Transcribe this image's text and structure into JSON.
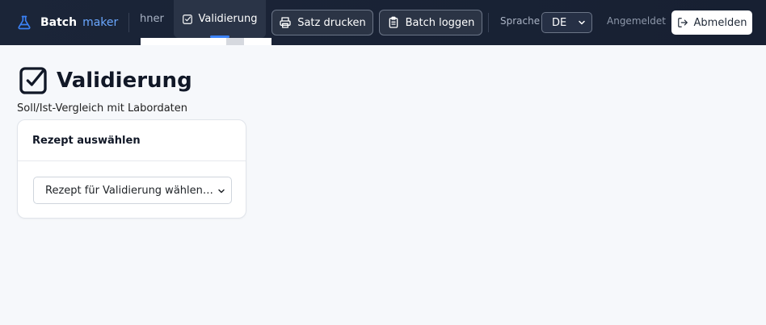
{
  "brand": {
    "part1": "Batch",
    "part2": "maker"
  },
  "nav": {
    "partial_item": "hner",
    "active_tab": "Validierung"
  },
  "toolbar": {
    "print_label": "Satz drucken",
    "log_label": "Batch loggen"
  },
  "language": {
    "label": "Sprache",
    "selected": "DE"
  },
  "user": {
    "status": "Angemeldet",
    "logout_label": "Abmelden"
  },
  "page": {
    "title": "Validierung",
    "subtitle": "Soll/Ist-Vergleich mit Labordaten"
  },
  "card": {
    "title": "Rezept auswählen",
    "select_placeholder": "Rezept für Validierung wählen…"
  },
  "colors": {
    "accent": "#3b82f6",
    "topbar": "#1b2538",
    "brand_highlight": "#6aa7ff"
  },
  "icons": {
    "brand": "flask-icon",
    "tab": "checkbox-icon",
    "print": "printer-icon",
    "log": "clipboard-icon",
    "logout": "logout-icon"
  }
}
